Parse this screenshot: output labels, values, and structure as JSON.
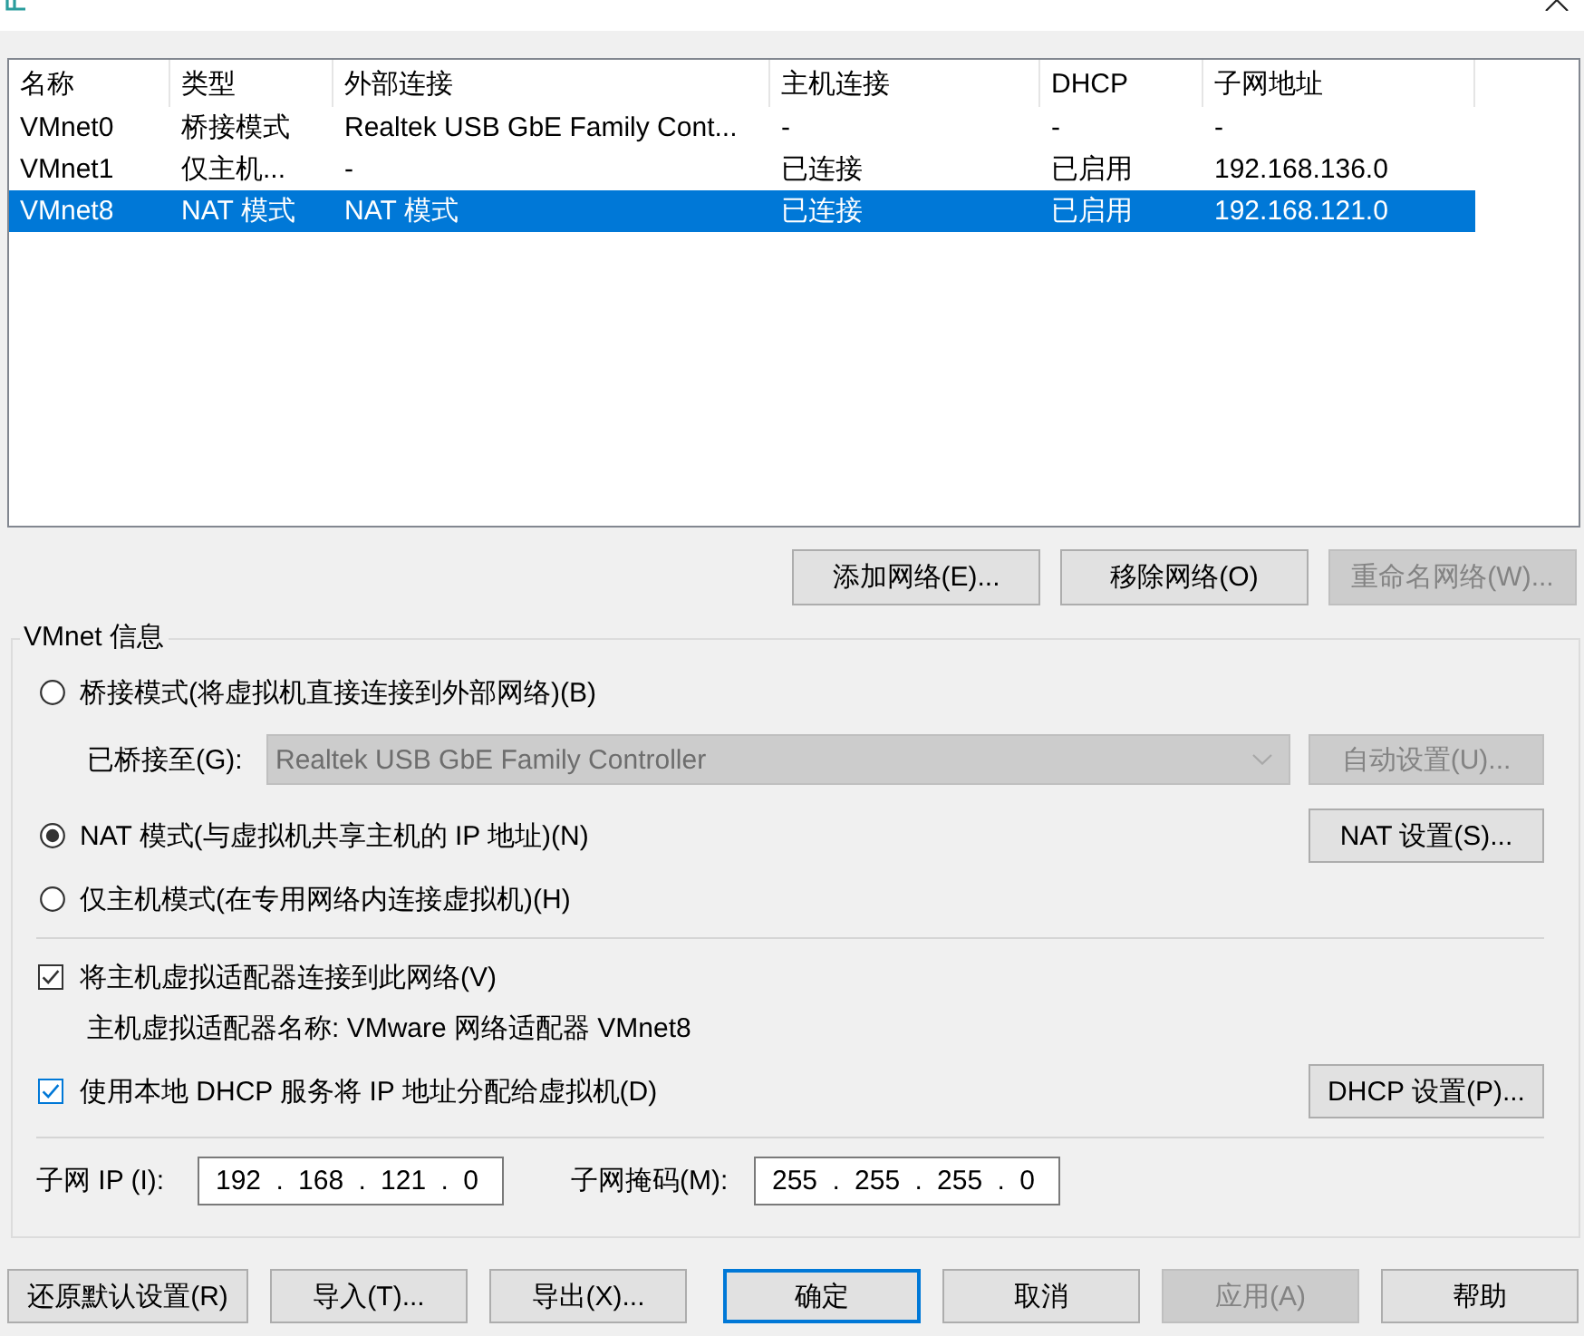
{
  "network_list": {
    "columns": [
      "名称",
      "类型",
      "外部连接",
      "主机连接",
      "DHCP",
      "子网地址"
    ],
    "rows": [
      {
        "cells": [
          "VMnet0",
          "桥接模式",
          "Realtek USB GbE Family Cont...",
          "-",
          "-",
          "-"
        ],
        "selected": false
      },
      {
        "cells": [
          "VMnet1",
          "仅主机...",
          "-",
          "已连接",
          "已启用",
          "192.168.136.0"
        ],
        "selected": false
      },
      {
        "cells": [
          "VMnet8",
          "NAT 模式",
          "NAT 模式",
          "已连接",
          "已启用",
          "192.168.121.0"
        ],
        "selected": true
      }
    ]
  },
  "list_buttons": [
    {
      "label": "添加网络(E)...",
      "disabled": false
    },
    {
      "label": "移除网络(O)",
      "disabled": false
    },
    {
      "label": "重命名网络(W)...",
      "disabled": true
    }
  ],
  "vmnet_info": {
    "title": "VMnet 信息",
    "modes": [
      {
        "label": "桥接模式(将虚拟机直接连接到外部网络)(B)",
        "selected": false
      },
      {
        "label": "NAT 模式(与虚拟机共享主机的 IP 地址)(N)",
        "selected": true,
        "button": {
          "label": "NAT 设置(S)...",
          "disabled": false
        }
      },
      {
        "label": "仅主机模式(在专用网络内连接虚拟机)(H)",
        "selected": false
      }
    ],
    "bridged_to": {
      "label": "已桥接至(G):",
      "value": "Realtek USB GbE Family Controller",
      "disabled": true,
      "button": {
        "label": "自动设置(U)...",
        "disabled": true
      }
    },
    "host_adapter": {
      "label": "将主机虚拟适配器连接到此网络(V)",
      "checked": true,
      "focused": false,
      "name_text": "主机虚拟适配器名称: VMware 网络适配器 VMnet8"
    },
    "dhcp": {
      "label": "使用本地 DHCP 服务将 IP 地址分配给虚拟机(D)",
      "checked": true,
      "focused": true,
      "button": {
        "label": "DHCP 设置(P)...",
        "disabled": false
      }
    },
    "subnet_ip": {
      "label": "子网 IP (I):",
      "value": "192 . 168 . 121 . 0"
    },
    "subnet_mask": {
      "label": "子网掩码(M):",
      "value": "255 . 255 . 255 . 0"
    }
  },
  "dialog_buttons": [
    {
      "label": "还原默认设置(R)",
      "disabled": false,
      "default": false
    },
    {
      "label": "导入(T)...",
      "disabled": false,
      "default": false
    },
    {
      "label": "导出(X)...",
      "disabled": false,
      "default": false
    },
    {
      "label": "确定",
      "disabled": false,
      "default": true
    },
    {
      "label": "取消",
      "disabled": false,
      "default": false
    },
    {
      "label": "应用(A)",
      "disabled": true,
      "default": false
    },
    {
      "label": "帮助",
      "disabled": false,
      "default": false
    }
  ]
}
